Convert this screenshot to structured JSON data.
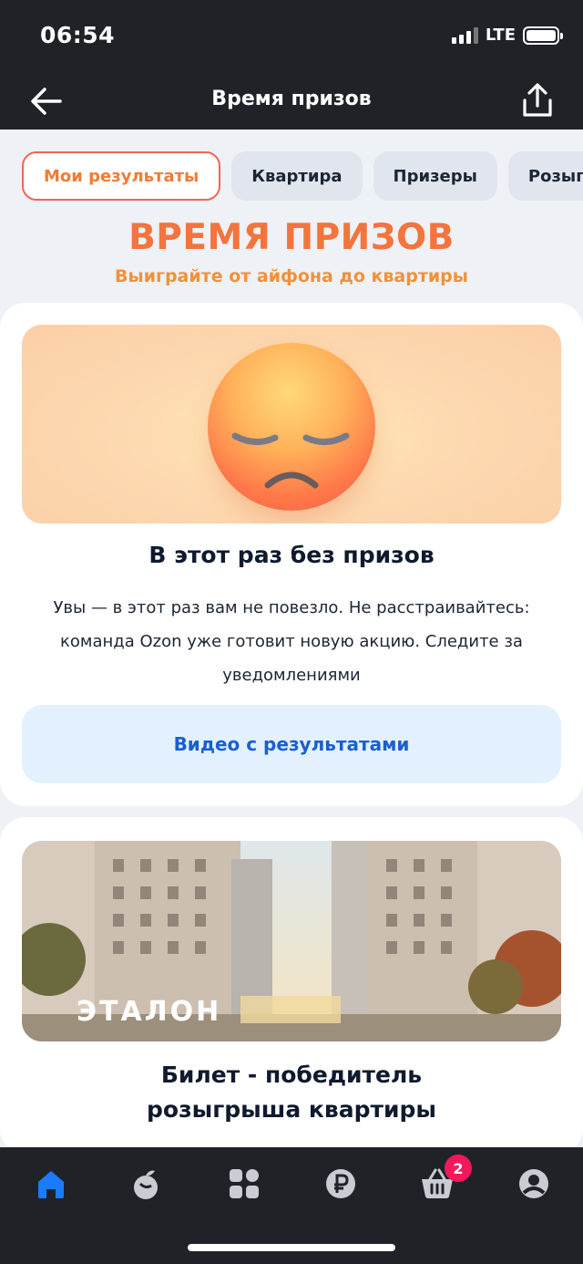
{
  "status_bar": {
    "time": "06:54",
    "network": "LTE"
  },
  "header": {
    "title": "Время призов",
    "back_icon": "arrow-left-icon",
    "share_icon": "share-icon"
  },
  "tabs": [
    {
      "label": "Мои результаты",
      "active": true
    },
    {
      "label": "Квартира",
      "active": false
    },
    {
      "label": "Призеры",
      "active": false
    },
    {
      "label": "Розыгры",
      "active": false
    }
  ],
  "promo": {
    "title": "ВРЕМЯ ПРИЗОВ",
    "subtitle": "Выиграйте от айфона до квартиры"
  },
  "result": {
    "title": "В этот раз без призов",
    "text": "Увы — в этот раз вам не повезло. Не расстраивайтесь: команда Ozon уже готовит новую акцию. Следите за уведомлениями",
    "video_button": "Видео с результатами"
  },
  "apartment": {
    "brand": "ЭТАЛОН",
    "title_line1": "Билет - победитель",
    "title_line2": "розыгрыша квартиры"
  },
  "bottom_nav": {
    "items": [
      "home-icon",
      "fresh-icon",
      "catalog-icon",
      "ruble-icon",
      "cart-icon",
      "profile-icon"
    ],
    "cart_badge": "2",
    "active_color": "#1a7bff"
  }
}
